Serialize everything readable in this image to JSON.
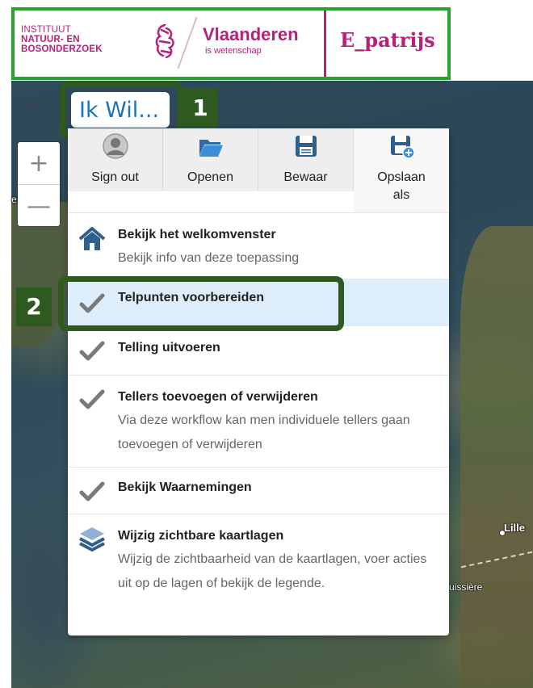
{
  "header": {
    "inbo_logo_lines": [
      "INSTITUUT",
      "NATUUR- EN",
      "BOSONDERZOEK"
    ],
    "vlaanderen_title": "Vlaanderen",
    "vlaanderen_subtitle": "is wetenschap",
    "app_title": "E_patrijs"
  },
  "controls": {
    "expand_toggle": ">",
    "zoom_in": "+",
    "zoom_out": "—"
  },
  "ik_wil_button": {
    "label": "Ik Wil..."
  },
  "steps": {
    "step1": "1",
    "step2": "2"
  },
  "toolbar": [
    {
      "label": "Sign out",
      "icon": "user-icon"
    },
    {
      "label": "Openen",
      "icon": "folder-open-icon"
    },
    {
      "label": "Bewaar",
      "icon": "save-icon"
    },
    {
      "label": "Opslaan als",
      "icon": "save-as-icon"
    }
  ],
  "menu": [
    {
      "title": "Bekijk het welkomvenster",
      "description": "Bekijk info van deze toepassing",
      "icon": "home-icon"
    },
    {
      "title": "Telpunten voorbereiden",
      "description": "",
      "icon": "check-icon",
      "active": true
    },
    {
      "title": "Telling uitvoeren",
      "description": "",
      "icon": "check-icon"
    },
    {
      "title": "Tellers toevoegen of verwijderen",
      "description": "Via deze workflow kan men individuele tellers gaan toevoegen of verwijderen",
      "icon": "check-icon"
    },
    {
      "title": "Bekijk Waarnemingen",
      "description": "",
      "icon": "check-icon"
    },
    {
      "title": "Wijzig zichtbare kaartlagen",
      "description": "Wijzig de zichtbaarheid van de kaartlagen, voer acties uit op de lagen of bekijk de legende.",
      "icon": "layers-icon"
    }
  ],
  "map_labels": {
    "city1": "Lille",
    "city2": "uissière",
    "edge_left": "e"
  },
  "colors": {
    "brand": "#b5207a",
    "highlight": "#2f5a1f",
    "header_border": "#28a32f",
    "link": "#1e74b8",
    "active_row": "#ddeefa"
  }
}
